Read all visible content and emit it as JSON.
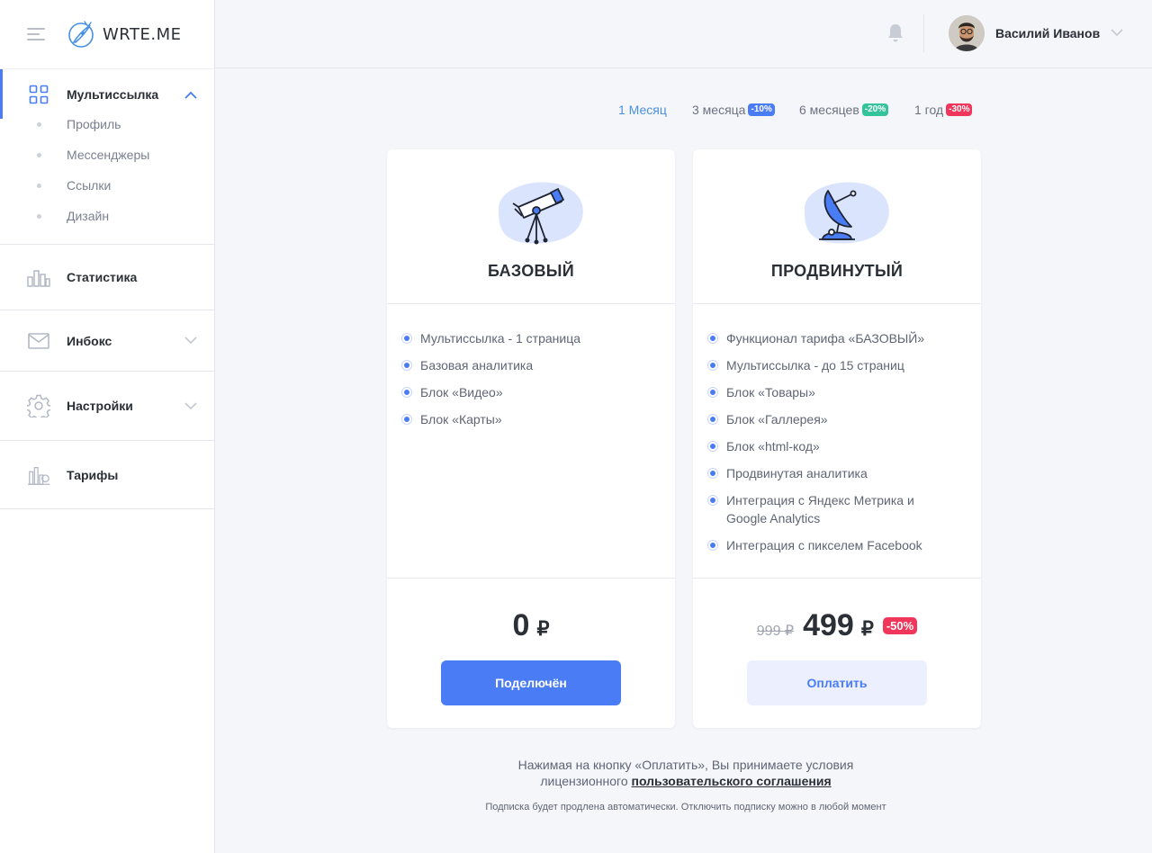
{
  "logo": {
    "text": "WRTE.ME"
  },
  "sidebar": {
    "multilink": {
      "label": "Мультиссылка",
      "items": [
        {
          "label": "Профиль"
        },
        {
          "label": "Мессенджеры"
        },
        {
          "label": "Ссылки"
        },
        {
          "label": "Дизайн"
        }
      ]
    },
    "statistics": {
      "label": "Статистика"
    },
    "inbox": {
      "label": "Инбокс"
    },
    "settings": {
      "label": "Настройки"
    },
    "tariffs": {
      "label": "Тарифы"
    }
  },
  "header": {
    "user_name": "Василий Иванов"
  },
  "periods": [
    {
      "label": "1 Месяц",
      "active": true
    },
    {
      "label": "3 месяца",
      "badge": "-10%",
      "badge_color": "#4a7cf6"
    },
    {
      "label": "6 месяцев",
      "badge": "-20%",
      "badge_color": "#34c39a"
    },
    {
      "label": "1 год",
      "badge": "-30%",
      "badge_color": "#f0365a"
    }
  ],
  "plans": {
    "basic": {
      "title": "БАЗОВЫЙ",
      "features": [
        "Мультиссылка - 1 страница",
        "Базовая аналитика",
        "Блок «Видео»",
        "Блок «Карты»"
      ],
      "price": "0",
      "currency": "₽",
      "button": "Поделючён"
    },
    "advanced": {
      "title": "ПРОДВИНУТЫЙ",
      "features": [
        "Функционал тарифа «БАЗОВЫЙ»",
        "Мультиссылка - до 15 страниц",
        "Блок «Товары»",
        "Блок «Галлерея»",
        "Блок «html-код»",
        "Продвинутая аналитика",
        "Интеграция с Яндекс Метрика и Google Analytics",
        "Интеграция с пикселем Facebook"
      ],
      "old_price": "999 ₽",
      "price": "499",
      "currency": "₽",
      "discount": "-50%",
      "button": "Оплатить"
    }
  },
  "legal": {
    "line1": "Нажимая на кнопку «Оплатить», Вы принимаете условия",
    "line2_prefix": "лицензионного",
    "link": "пользовательского соглашения",
    "note": "Подписка будет продлена автоматически. Отключить подписку можно в любой момент"
  },
  "colors": {
    "accent": "#4a7cf6",
    "danger": "#f0365a",
    "success": "#34c39a"
  }
}
